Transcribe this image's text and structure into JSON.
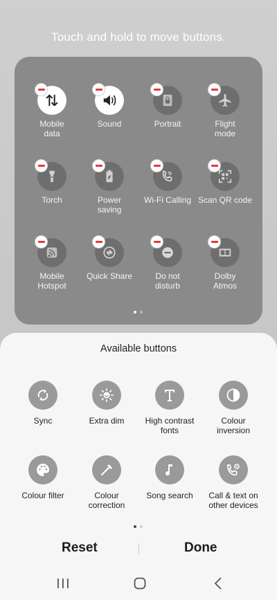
{
  "hint": "Touch and hold to move buttons.",
  "active_tiles": [
    {
      "label": "Mobile\ndata",
      "icon": "mobile-data-icon",
      "on": true
    },
    {
      "label": "Sound",
      "icon": "sound-icon",
      "on": true
    },
    {
      "label": "Portrait",
      "icon": "portrait-lock-icon",
      "on": false
    },
    {
      "label": "Flight\nmode",
      "icon": "airplane-icon",
      "on": false
    },
    {
      "label": "Torch",
      "icon": "torch-icon",
      "on": false
    },
    {
      "label": "Power\nsaving",
      "icon": "power-saving-icon",
      "on": false
    },
    {
      "label": "Wi-Fi Calling",
      "icon": "wifi-calling-icon",
      "on": false
    },
    {
      "label": "Scan QR code",
      "icon": "qr-code-icon",
      "on": false
    },
    {
      "label": "Mobile\nHotspot",
      "icon": "hotspot-icon",
      "on": false
    },
    {
      "label": "Quick Share",
      "icon": "quick-share-icon",
      "on": false
    },
    {
      "label": "Do not\ndisturb",
      "icon": "do-not-disturb-icon",
      "on": false
    },
    {
      "label": "Dolby\nAtmos",
      "icon": "dolby-atmos-icon",
      "on": false
    }
  ],
  "available": {
    "title": "Available buttons",
    "items": [
      {
        "label": "Sync",
        "icon": "sync-icon"
      },
      {
        "label": "Extra dim",
        "icon": "extra-dim-icon"
      },
      {
        "label": "High contrast\nfonts",
        "icon": "high-contrast-fonts-icon"
      },
      {
        "label": "Colour\ninversion",
        "icon": "colour-inversion-icon"
      },
      {
        "label": "Colour filter",
        "icon": "colour-filter-icon"
      },
      {
        "label": "Colour\ncorrection",
        "icon": "colour-correction-icon"
      },
      {
        "label": "Song search",
        "icon": "song-search-icon"
      },
      {
        "label": "Call & text on\nother devices",
        "icon": "call-text-other-devices-icon"
      }
    ]
  },
  "actions": {
    "reset": "Reset",
    "done": "Done"
  },
  "nav": {
    "recents": "recents-icon",
    "home": "home-icon",
    "back": "back-icon"
  }
}
